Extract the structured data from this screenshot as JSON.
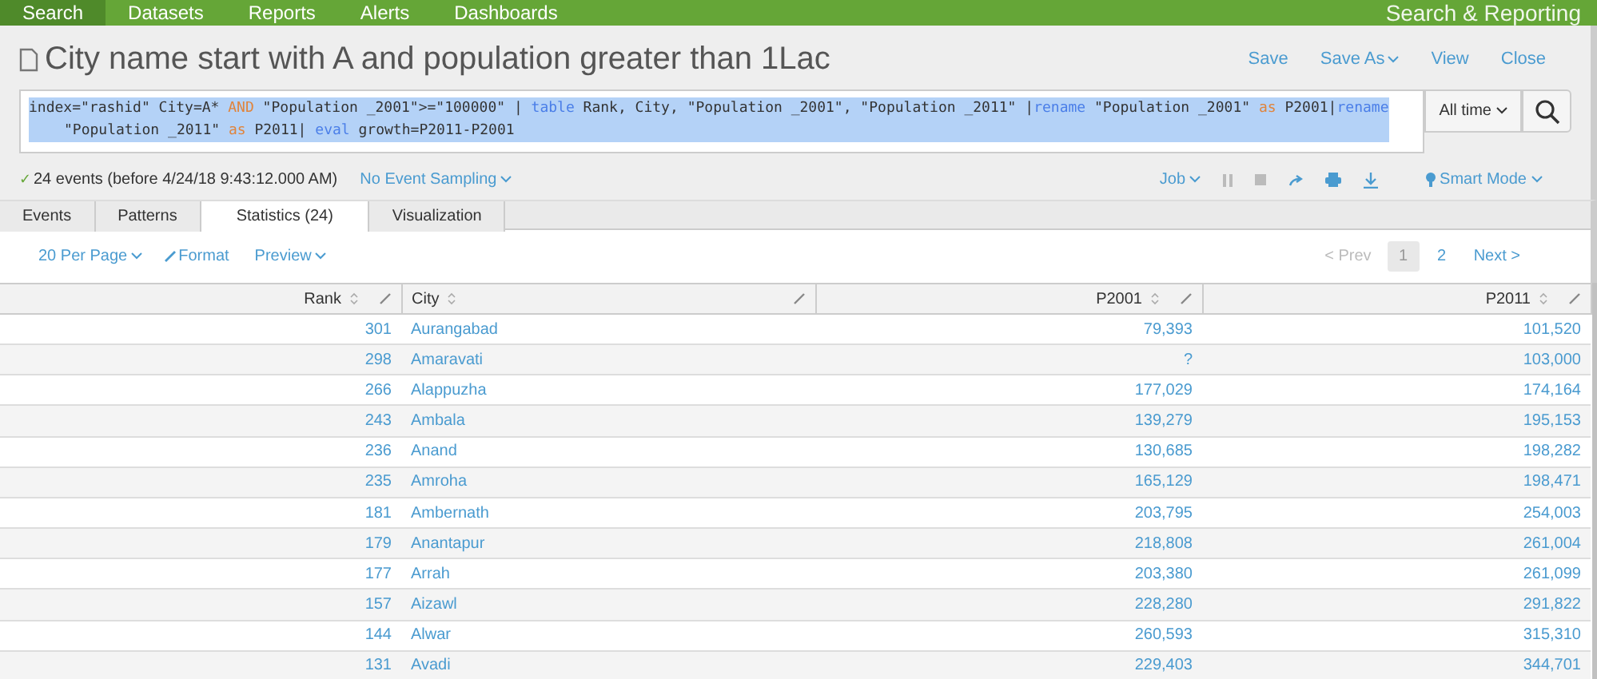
{
  "nav": {
    "items": [
      {
        "label": "Search",
        "selected": true
      },
      {
        "label": "Datasets",
        "selected": false
      },
      {
        "label": "Reports",
        "selected": false
      },
      {
        "label": "Alerts",
        "selected": false
      },
      {
        "label": "Dashboards",
        "selected": false
      }
    ],
    "app_title": "Search & Reporting"
  },
  "title": "City name start with A and population greater than 1Lac",
  "title_actions": [
    {
      "label": "Save",
      "dropdown": false
    },
    {
      "label": "Save As",
      "dropdown": true
    },
    {
      "label": "View",
      "dropdown": false
    },
    {
      "label": "Close",
      "dropdown": false
    }
  ],
  "query": {
    "lines": [
      [
        {
          "kind": "plain",
          "text": "index=\"rashid\" City=A* "
        },
        {
          "kind": "keyword",
          "text": "AND"
        },
        {
          "kind": "plain",
          "text": " \"Population _2001\">=\"100000\" | "
        },
        {
          "kind": "command",
          "text": "table"
        },
        {
          "kind": "plain",
          "text": " Rank, City, \"Population _2001\", \"Population _2011\" |"
        },
        {
          "kind": "command",
          "text": "rename"
        },
        {
          "kind": "plain",
          "text": " \"Population _2001\" "
        },
        {
          "kind": "keyword",
          "text": "as"
        },
        {
          "kind": "plain",
          "text": " P2001|"
        },
        {
          "kind": "command",
          "text": "rename"
        }
      ],
      [
        {
          "kind": "plain",
          "text": "\"Population _2011\" "
        },
        {
          "kind": "keyword",
          "text": "as"
        },
        {
          "kind": "plain",
          "text": " P2011| "
        },
        {
          "kind": "command",
          "text": "eval"
        },
        {
          "kind": "plain",
          "text": " growth=P2011-P2001"
        }
      ]
    ],
    "time_range": "All time"
  },
  "status": {
    "check": "✓",
    "summary": "24 events (before 4/24/18 9:43:12.000 AM)",
    "sampling": "No Event Sampling"
  },
  "job_bar": {
    "job": "Job",
    "mode": "Smart Mode"
  },
  "tabs": [
    {
      "label": "Events",
      "selected": false
    },
    {
      "label": "Patterns",
      "selected": false
    },
    {
      "label": "Statistics (24)",
      "selected": true
    },
    {
      "label": "Visualization",
      "selected": false
    }
  ],
  "table_controls": {
    "per_page": "20 Per Page",
    "format": "Format",
    "preview": "Preview"
  },
  "pagination": {
    "prev": "< Prev",
    "pages": [
      {
        "label": "1",
        "selected": true
      },
      {
        "label": "2",
        "selected": false
      }
    ],
    "next": "Next >"
  },
  "table": {
    "columns": [
      {
        "label": "Rank"
      },
      {
        "label": "City"
      },
      {
        "label": "P2001"
      },
      {
        "label": "P2011"
      }
    ],
    "rows": [
      [
        "301",
        "Aurangabad",
        "79,393",
        "101,520"
      ],
      [
        "298",
        "Amaravati",
        "?",
        "103,000"
      ],
      [
        "266",
        "Alappuzha",
        "177,029",
        "174,164"
      ],
      [
        "243",
        "Ambala",
        "139,279",
        "195,153"
      ],
      [
        "236",
        "Anand",
        "130,685",
        "198,282"
      ],
      [
        "235",
        "Amroha",
        "165,129",
        "198,471"
      ],
      [
        "181",
        "Ambernath",
        "203,795",
        "254,003"
      ],
      [
        "179",
        "Anantapur",
        "218,808",
        "261,004"
      ],
      [
        "177",
        "Arrah",
        "203,380",
        "261,099"
      ],
      [
        "157",
        "Aizawl",
        "228,280",
        "291,822"
      ],
      [
        "144",
        "Alwar",
        "260,593",
        "315,310"
      ],
      [
        "131",
        "Avadi",
        "229,403",
        "344,701"
      ]
    ]
  }
}
